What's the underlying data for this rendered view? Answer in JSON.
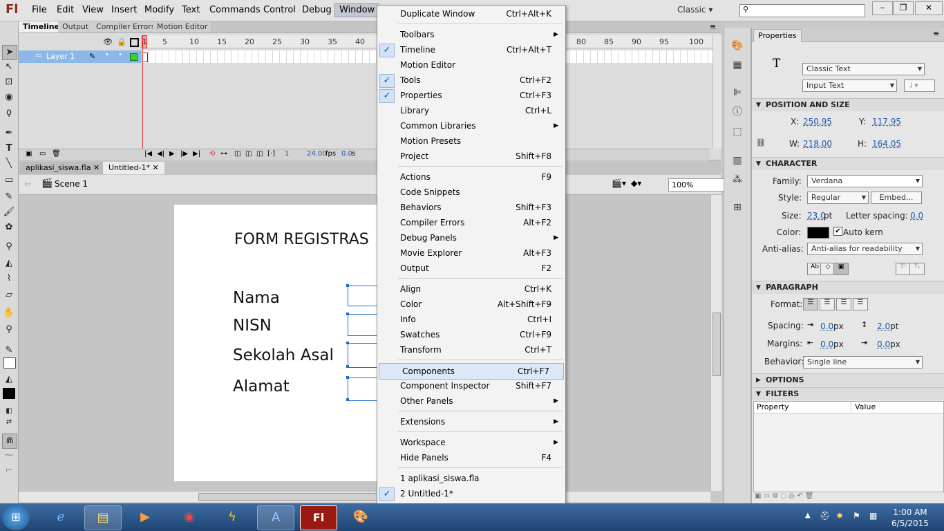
{
  "app": {
    "logo": "Fl",
    "workspace": "Classic"
  },
  "menubar": [
    "File",
    "Edit",
    "View",
    "Insert",
    "Modify",
    "Text",
    "Commands",
    "Control",
    "Debug",
    "Window"
  ],
  "timeline": {
    "tabs": [
      "Timeline",
      "Output",
      "Compiler Errors",
      "Motion Editor"
    ],
    "frame_numbers": [
      "1",
      "5",
      "10",
      "15",
      "20",
      "25",
      "30",
      "35",
      "40",
      "80",
      "85",
      "90",
      "95",
      "100"
    ],
    "layer_name": "Layer 1",
    "current_frame": "1",
    "fps": "24.00",
    "fps_unit": "fps",
    "time": "0.0",
    "time_unit": "s"
  },
  "doc_tabs": [
    "aplikasi_siswa.fla",
    "Untitled-1*"
  ],
  "edit_bar": {
    "scene": "Scene 1",
    "zoom": "100%"
  },
  "stage": {
    "title": "FORM REGISTRAS",
    "labels": [
      "Nama",
      "NISN",
      "Sekolah Asal",
      "Alamat"
    ]
  },
  "window_menu": {
    "items": [
      {
        "label": "Duplicate Window",
        "shortcut": "Ctrl+Alt+K"
      },
      {
        "sep": true
      },
      {
        "label": "Toolbars",
        "submenu": true
      },
      {
        "label": "Timeline",
        "shortcut": "Ctrl+Alt+T",
        "checked": true
      },
      {
        "label": "Motion Editor"
      },
      {
        "label": "Tools",
        "shortcut": "Ctrl+F2",
        "checked": true
      },
      {
        "label": "Properties",
        "shortcut": "Ctrl+F3",
        "checked": true
      },
      {
        "label": "Library",
        "shortcut": "Ctrl+L"
      },
      {
        "label": "Common Libraries",
        "submenu": true
      },
      {
        "label": "Motion Presets"
      },
      {
        "label": "Project",
        "shortcut": "Shift+F8"
      },
      {
        "sep": true
      },
      {
        "label": "Actions",
        "shortcut": "F9"
      },
      {
        "label": "Code Snippets"
      },
      {
        "label": "Behaviors",
        "shortcut": "Shift+F3"
      },
      {
        "label": "Compiler Errors",
        "shortcut": "Alt+F2"
      },
      {
        "label": "Debug Panels",
        "submenu": true
      },
      {
        "label": "Movie Explorer",
        "shortcut": "Alt+F3"
      },
      {
        "label": "Output",
        "shortcut": "F2"
      },
      {
        "sep": true
      },
      {
        "label": "Align",
        "shortcut": "Ctrl+K"
      },
      {
        "label": "Color",
        "shortcut": "Alt+Shift+F9"
      },
      {
        "label": "Info",
        "shortcut": "Ctrl+I"
      },
      {
        "label": "Swatches",
        "shortcut": "Ctrl+F9"
      },
      {
        "label": "Transform",
        "shortcut": "Ctrl+T"
      },
      {
        "sep": true
      },
      {
        "label": "Components",
        "shortcut": "Ctrl+F7",
        "highlighted": true
      },
      {
        "label": "Component Inspector",
        "shortcut": "Shift+F7"
      },
      {
        "label": "Other Panels",
        "submenu": true
      },
      {
        "sep": true
      },
      {
        "label": "Extensions",
        "submenu": true
      },
      {
        "sep": true
      },
      {
        "label": "Workspace",
        "submenu": true
      },
      {
        "label": "Hide Panels",
        "shortcut": "F4"
      },
      {
        "sep": true
      },
      {
        "label": "1 aplikasi_siswa.fla"
      },
      {
        "label": "2 Untitled-1*",
        "checked": true
      }
    ]
  },
  "properties": {
    "tab": "Properties",
    "text_engine": "Classic Text",
    "text_type": "Input Text",
    "pos_size": {
      "title": "POSITION AND SIZE",
      "x_label": "X:",
      "x": "250.95",
      "y_label": "Y:",
      "y": "117.95",
      "w_label": "W:",
      "w": "218.00",
      "h_label": "H:",
      "h": "164.05"
    },
    "character": {
      "title": "CHARACTER",
      "family_label": "Family:",
      "family": "Verdana",
      "style_label": "Style:",
      "style": "Regular",
      "embed": "Embed...",
      "size_label": "Size:",
      "size": "23.0",
      "size_unit": "pt",
      "ls_label": "Letter spacing:",
      "ls": "0.0",
      "color_label": "Color:",
      "color": "#000000",
      "autokern": "Auto kern",
      "aa_label": "Anti-alias:",
      "aa": "Anti-alias for readability"
    },
    "paragraph": {
      "title": "PARAGRAPH",
      "format_label": "Format:",
      "spacing_label": "Spacing:",
      "sp1": "0.0",
      "sp1_unit": "px",
      "sp2": "2.0",
      "sp2_unit": "pt",
      "margins_label": "Margins:",
      "m1": "0.0",
      "m1_unit": "px",
      "m2": "0.0",
      "m2_unit": "px",
      "behavior_label": "Behavior:",
      "behavior": "Single line"
    },
    "options_title": "OPTIONS",
    "filters": {
      "title": "FILTERS",
      "col1": "Property",
      "col2": "Value"
    }
  },
  "taskbar": {
    "time": "1:00 AM",
    "date": "6/5/2015"
  }
}
